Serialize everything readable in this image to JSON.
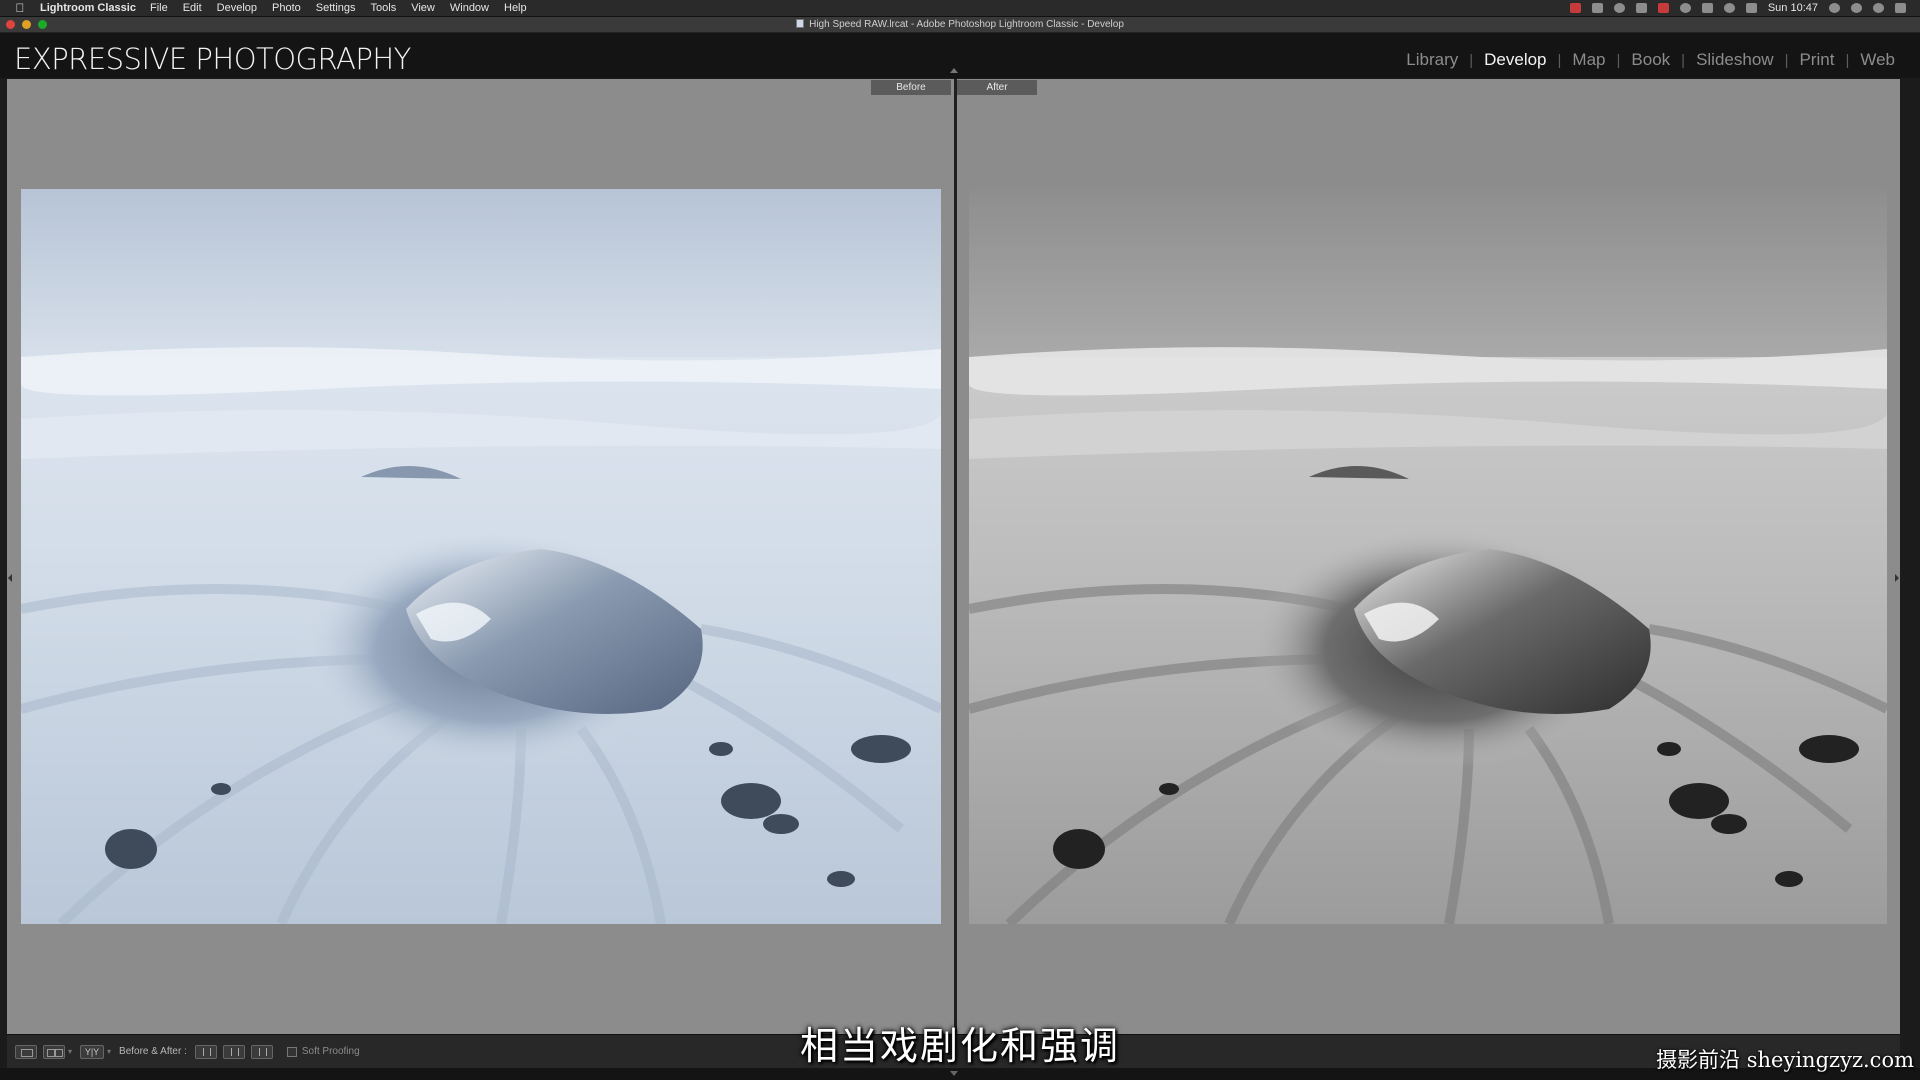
{
  "menubar": {
    "app_name": "Lightroom Classic",
    "items": [
      "File",
      "Edit",
      "Develop",
      "Photo",
      "Settings",
      "Tools",
      "View",
      "Window",
      "Help"
    ],
    "clock": "Sun 10:47"
  },
  "window": {
    "title": "High Speed RAW.lrcat - Adobe Photoshop Lightroom Classic - Develop"
  },
  "identity_plate": "EXPRESSIVE PHOTOGRAPHY",
  "modules": [
    {
      "label": "Library",
      "active": false
    },
    {
      "label": "Develop",
      "active": true
    },
    {
      "label": "Map",
      "active": false
    },
    {
      "label": "Book",
      "active": false
    },
    {
      "label": "Slideshow",
      "active": false
    },
    {
      "label": "Print",
      "active": false
    },
    {
      "label": "Web",
      "active": false
    }
  ],
  "compare": {
    "before_label": "Before",
    "after_label": "After"
  },
  "toolbar": {
    "yy_label": "Y|Y",
    "before_after_label": "Before & After :",
    "soft_proofing_label": "Soft Proofing",
    "soft_proofing_checked": false
  },
  "overlay": {
    "subtitle": "相当戏剧化和强调",
    "watermark": "摄影前沿 sheyingzyz.com"
  },
  "icons": {
    "apple": "apple-icon",
    "photo_subject": "ice-on-black-sand-beach"
  },
  "colors": {
    "workspace_bg": "#8c8c8c",
    "before_tone": "#c9d6e6",
    "after_tone": "#b5b5b5"
  }
}
